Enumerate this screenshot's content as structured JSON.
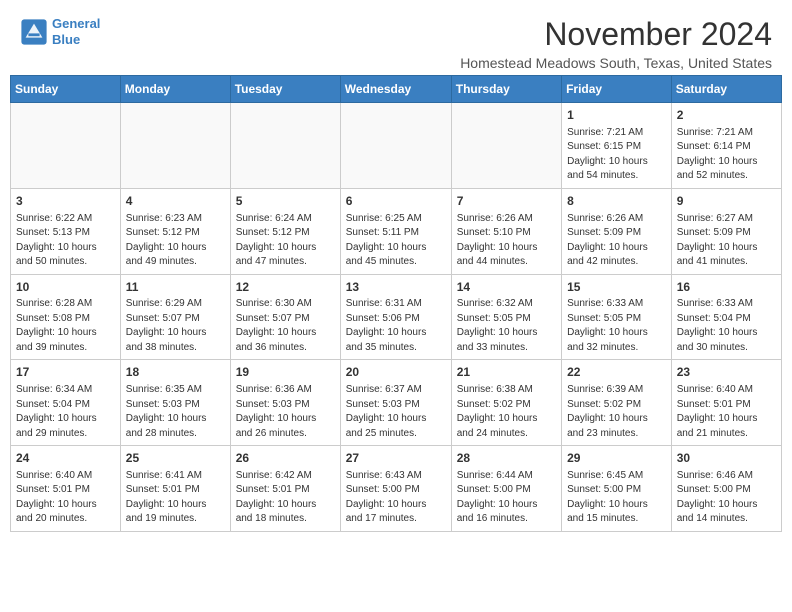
{
  "header": {
    "logo_line1": "General",
    "logo_line2": "Blue",
    "month": "November 2024",
    "location": "Homestead Meadows South, Texas, United States"
  },
  "weekdays": [
    "Sunday",
    "Monday",
    "Tuesday",
    "Wednesday",
    "Thursday",
    "Friday",
    "Saturday"
  ],
  "weeks": [
    [
      {
        "day": "",
        "info": ""
      },
      {
        "day": "",
        "info": ""
      },
      {
        "day": "",
        "info": ""
      },
      {
        "day": "",
        "info": ""
      },
      {
        "day": "",
        "info": ""
      },
      {
        "day": "1",
        "info": "Sunrise: 7:21 AM\nSunset: 6:15 PM\nDaylight: 10 hours and 54 minutes."
      },
      {
        "day": "2",
        "info": "Sunrise: 7:21 AM\nSunset: 6:14 PM\nDaylight: 10 hours and 52 minutes."
      }
    ],
    [
      {
        "day": "3",
        "info": "Sunrise: 6:22 AM\nSunset: 5:13 PM\nDaylight: 10 hours and 50 minutes."
      },
      {
        "day": "4",
        "info": "Sunrise: 6:23 AM\nSunset: 5:12 PM\nDaylight: 10 hours and 49 minutes."
      },
      {
        "day": "5",
        "info": "Sunrise: 6:24 AM\nSunset: 5:12 PM\nDaylight: 10 hours and 47 minutes."
      },
      {
        "day": "6",
        "info": "Sunrise: 6:25 AM\nSunset: 5:11 PM\nDaylight: 10 hours and 45 minutes."
      },
      {
        "day": "7",
        "info": "Sunrise: 6:26 AM\nSunset: 5:10 PM\nDaylight: 10 hours and 44 minutes."
      },
      {
        "day": "8",
        "info": "Sunrise: 6:26 AM\nSunset: 5:09 PM\nDaylight: 10 hours and 42 minutes."
      },
      {
        "day": "9",
        "info": "Sunrise: 6:27 AM\nSunset: 5:09 PM\nDaylight: 10 hours and 41 minutes."
      }
    ],
    [
      {
        "day": "10",
        "info": "Sunrise: 6:28 AM\nSunset: 5:08 PM\nDaylight: 10 hours and 39 minutes."
      },
      {
        "day": "11",
        "info": "Sunrise: 6:29 AM\nSunset: 5:07 PM\nDaylight: 10 hours and 38 minutes."
      },
      {
        "day": "12",
        "info": "Sunrise: 6:30 AM\nSunset: 5:07 PM\nDaylight: 10 hours and 36 minutes."
      },
      {
        "day": "13",
        "info": "Sunrise: 6:31 AM\nSunset: 5:06 PM\nDaylight: 10 hours and 35 minutes."
      },
      {
        "day": "14",
        "info": "Sunrise: 6:32 AM\nSunset: 5:05 PM\nDaylight: 10 hours and 33 minutes."
      },
      {
        "day": "15",
        "info": "Sunrise: 6:33 AM\nSunset: 5:05 PM\nDaylight: 10 hours and 32 minutes."
      },
      {
        "day": "16",
        "info": "Sunrise: 6:33 AM\nSunset: 5:04 PM\nDaylight: 10 hours and 30 minutes."
      }
    ],
    [
      {
        "day": "17",
        "info": "Sunrise: 6:34 AM\nSunset: 5:04 PM\nDaylight: 10 hours and 29 minutes."
      },
      {
        "day": "18",
        "info": "Sunrise: 6:35 AM\nSunset: 5:03 PM\nDaylight: 10 hours and 28 minutes."
      },
      {
        "day": "19",
        "info": "Sunrise: 6:36 AM\nSunset: 5:03 PM\nDaylight: 10 hours and 26 minutes."
      },
      {
        "day": "20",
        "info": "Sunrise: 6:37 AM\nSunset: 5:03 PM\nDaylight: 10 hours and 25 minutes."
      },
      {
        "day": "21",
        "info": "Sunrise: 6:38 AM\nSunset: 5:02 PM\nDaylight: 10 hours and 24 minutes."
      },
      {
        "day": "22",
        "info": "Sunrise: 6:39 AM\nSunset: 5:02 PM\nDaylight: 10 hours and 23 minutes."
      },
      {
        "day": "23",
        "info": "Sunrise: 6:40 AM\nSunset: 5:01 PM\nDaylight: 10 hours and 21 minutes."
      }
    ],
    [
      {
        "day": "24",
        "info": "Sunrise: 6:40 AM\nSunset: 5:01 PM\nDaylight: 10 hours and 20 minutes."
      },
      {
        "day": "25",
        "info": "Sunrise: 6:41 AM\nSunset: 5:01 PM\nDaylight: 10 hours and 19 minutes."
      },
      {
        "day": "26",
        "info": "Sunrise: 6:42 AM\nSunset: 5:01 PM\nDaylight: 10 hours and 18 minutes."
      },
      {
        "day": "27",
        "info": "Sunrise: 6:43 AM\nSunset: 5:00 PM\nDaylight: 10 hours and 17 minutes."
      },
      {
        "day": "28",
        "info": "Sunrise: 6:44 AM\nSunset: 5:00 PM\nDaylight: 10 hours and 16 minutes."
      },
      {
        "day": "29",
        "info": "Sunrise: 6:45 AM\nSunset: 5:00 PM\nDaylight: 10 hours and 15 minutes."
      },
      {
        "day": "30",
        "info": "Sunrise: 6:46 AM\nSunset: 5:00 PM\nDaylight: 10 hours and 14 minutes."
      }
    ]
  ]
}
